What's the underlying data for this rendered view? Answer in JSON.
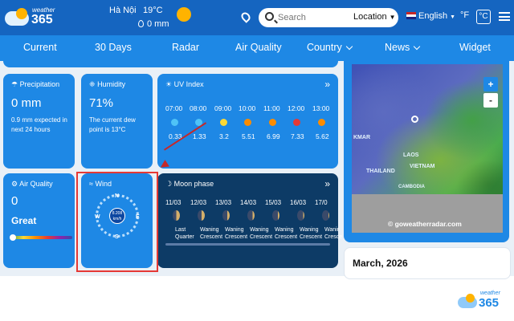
{
  "header": {
    "logo_top": "weather",
    "logo_num": "365",
    "city": "Hà Nội",
    "temperature": "19°C",
    "rain": "0 mm",
    "search_placeholder": "Search",
    "location_label": "Location",
    "language": "English",
    "unit_f": "°F",
    "unit_c": "°C"
  },
  "nav": [
    "Current",
    "30 Days",
    "Radar",
    "Air Quality",
    "Country",
    "News",
    "Widget"
  ],
  "precipitation": {
    "title": "Precipitation",
    "value": "0 mm",
    "desc": "0.9 mm expected in next 24 hours"
  },
  "humidity": {
    "title": "Humidity",
    "value": "71%",
    "desc": "The current dew point is 13°C"
  },
  "uv": {
    "title": "UV Index",
    "times": [
      "07:00",
      "08:00",
      "09:00",
      "10:00",
      "11:00",
      "12:00",
      "13:00"
    ],
    "values": [
      "0.33",
      "1.33",
      "3.2",
      "5.51",
      "6.99",
      "7.33",
      "5.62"
    ],
    "colors": [
      "#4fc3f7",
      "#4fc3f7",
      "#fdd835",
      "#fb8c00",
      "#fb8c00",
      "#e53935",
      "#fb8c00"
    ]
  },
  "air_quality": {
    "title": "Air Quality",
    "value": "0",
    "status": "Great"
  },
  "wind": {
    "title": "Wind",
    "speed": "8.208",
    "unit": "km/h",
    "n": "N",
    "s": "S",
    "e": "E",
    "w": "W"
  },
  "moon": {
    "title": "Moon phase",
    "dates": [
      "11/03",
      "12/03",
      "13/03",
      "14/03",
      "15/03",
      "16/03",
      "17/0"
    ],
    "phases": [
      [
        "Last",
        "Quarter"
      ],
      [
        "Waning",
        "Crescent"
      ],
      [
        "Waning",
        "Crescent"
      ],
      [
        "Waning",
        "Crescent"
      ],
      [
        "Waning",
        "Crescent"
      ],
      [
        "Waning",
        "Crescent"
      ],
      [
        "Wanir",
        "Cresce"
      ]
    ]
  },
  "map": {
    "labels": [
      "KMAR",
      "LAOS",
      "THAILAND",
      "VIETNAM",
      "CAMBODIA"
    ],
    "credit": "© goweatherradar.com",
    "zoom_in": "+",
    "zoom_out": "-"
  },
  "calendar": {
    "month": "March, 2026"
  },
  "footer": {
    "logo_top": "weather",
    "logo_num": "365"
  }
}
